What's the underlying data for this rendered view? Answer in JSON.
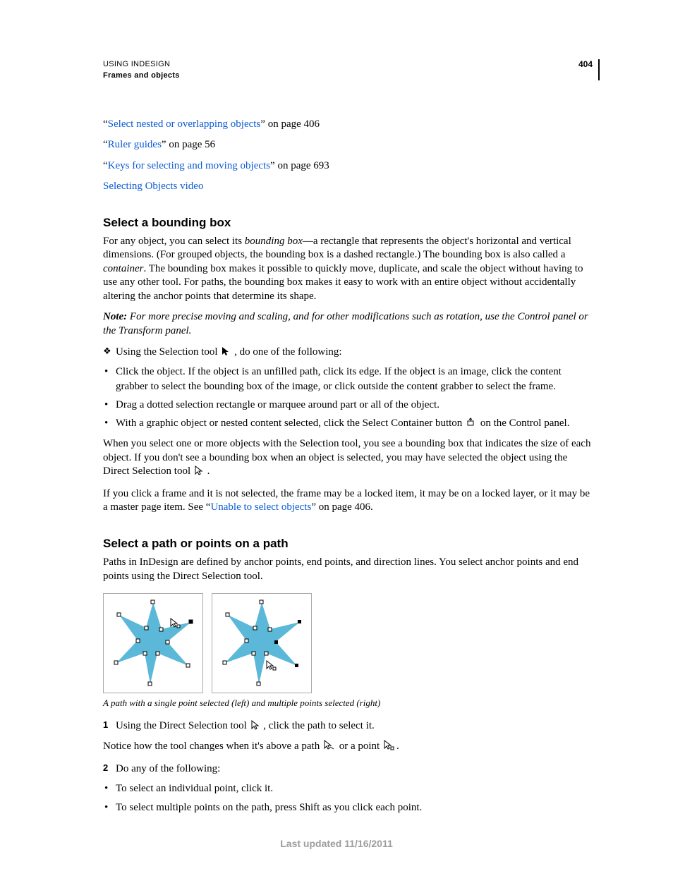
{
  "header": {
    "doc_title": "USING INDESIGN",
    "section": "Frames and objects",
    "page_number": "404"
  },
  "refs": [
    {
      "pre": "“",
      "link": "Select nested or overlapping objects",
      "post": "” on page 406"
    },
    {
      "pre": "“",
      "link": "Ruler guides",
      "post": "” on page 56"
    },
    {
      "pre": "“",
      "link": "Keys for selecting and moving objects",
      "post": "” on page 693"
    },
    {
      "pre": "",
      "link": "Selecting Objects video",
      "post": ""
    }
  ],
  "s1": {
    "heading": "Select a bounding box",
    "p1a": "For any object, you can select its ",
    "p1b": "bounding box",
    "p1c": "—a rectangle that represents the object's horizontal and vertical dimensions. (For grouped objects, the bounding box is a dashed rectangle.) The bounding box is also called a ",
    "p1d": "container",
    "p1e": ". The bounding box makes it possible to quickly move, duplicate, and scale the object without having to use any other tool. For paths, the bounding box makes it easy to work with an entire object without accidentally altering the anchor points that determine its shape.",
    "note_label": "Note:",
    "note": " For more precise moving and scaling, and for other modifications such as rotation, use the Control panel or the Transform panel.",
    "lead_a": "Using the Selection tool ",
    "lead_b": " , do one of the following:",
    "bullets": [
      "Click the object. If the object is an unfilled path, click its edge. If the object is an image, click the content grabber to select the bounding box of the image, or click outside the content grabber to select the frame.",
      "Drag a dotted selection rectangle or marquee around part or all of the object."
    ],
    "bullet3a": "With a graphic object or nested content selected, click the Select Container button ",
    "bullet3b": " on the Control panel.",
    "p2a": "When you select one or more objects with the Selection tool, you see a bounding box that indicates the size of each object. If you don't see a bounding box when an object is selected, you may have selected the object using the Direct Selection tool ",
    "p2b": " .",
    "p3a": "If you click a frame and it is not selected, the frame may be a locked item, it may be on a locked layer, or it may be a master page item. See “",
    "p3link": "Unable to select objects",
    "p3b": "” on page 406."
  },
  "s2": {
    "heading": "Select a path or points on a path",
    "p1": "Paths in InDesign are defined by anchor points, end points, and direction lines. You select anchor points and end points using the Direct Selection tool.",
    "caption": "A path with a single point selected (left) and multiple points selected (right)",
    "step1a": "Using the Direct Selection tool ",
    "step1b": " , click the path to select it.",
    "p2a": "Notice how the tool changes when it's above a path ",
    "p2b": " or a point ",
    "p2c": ".",
    "step2": "Do any of the following:",
    "bullets": [
      "To select an individual point, click it.",
      "To select multiple points on the path, press Shift as you click each point."
    ]
  },
  "footer": "Last updated 11/16/2011"
}
